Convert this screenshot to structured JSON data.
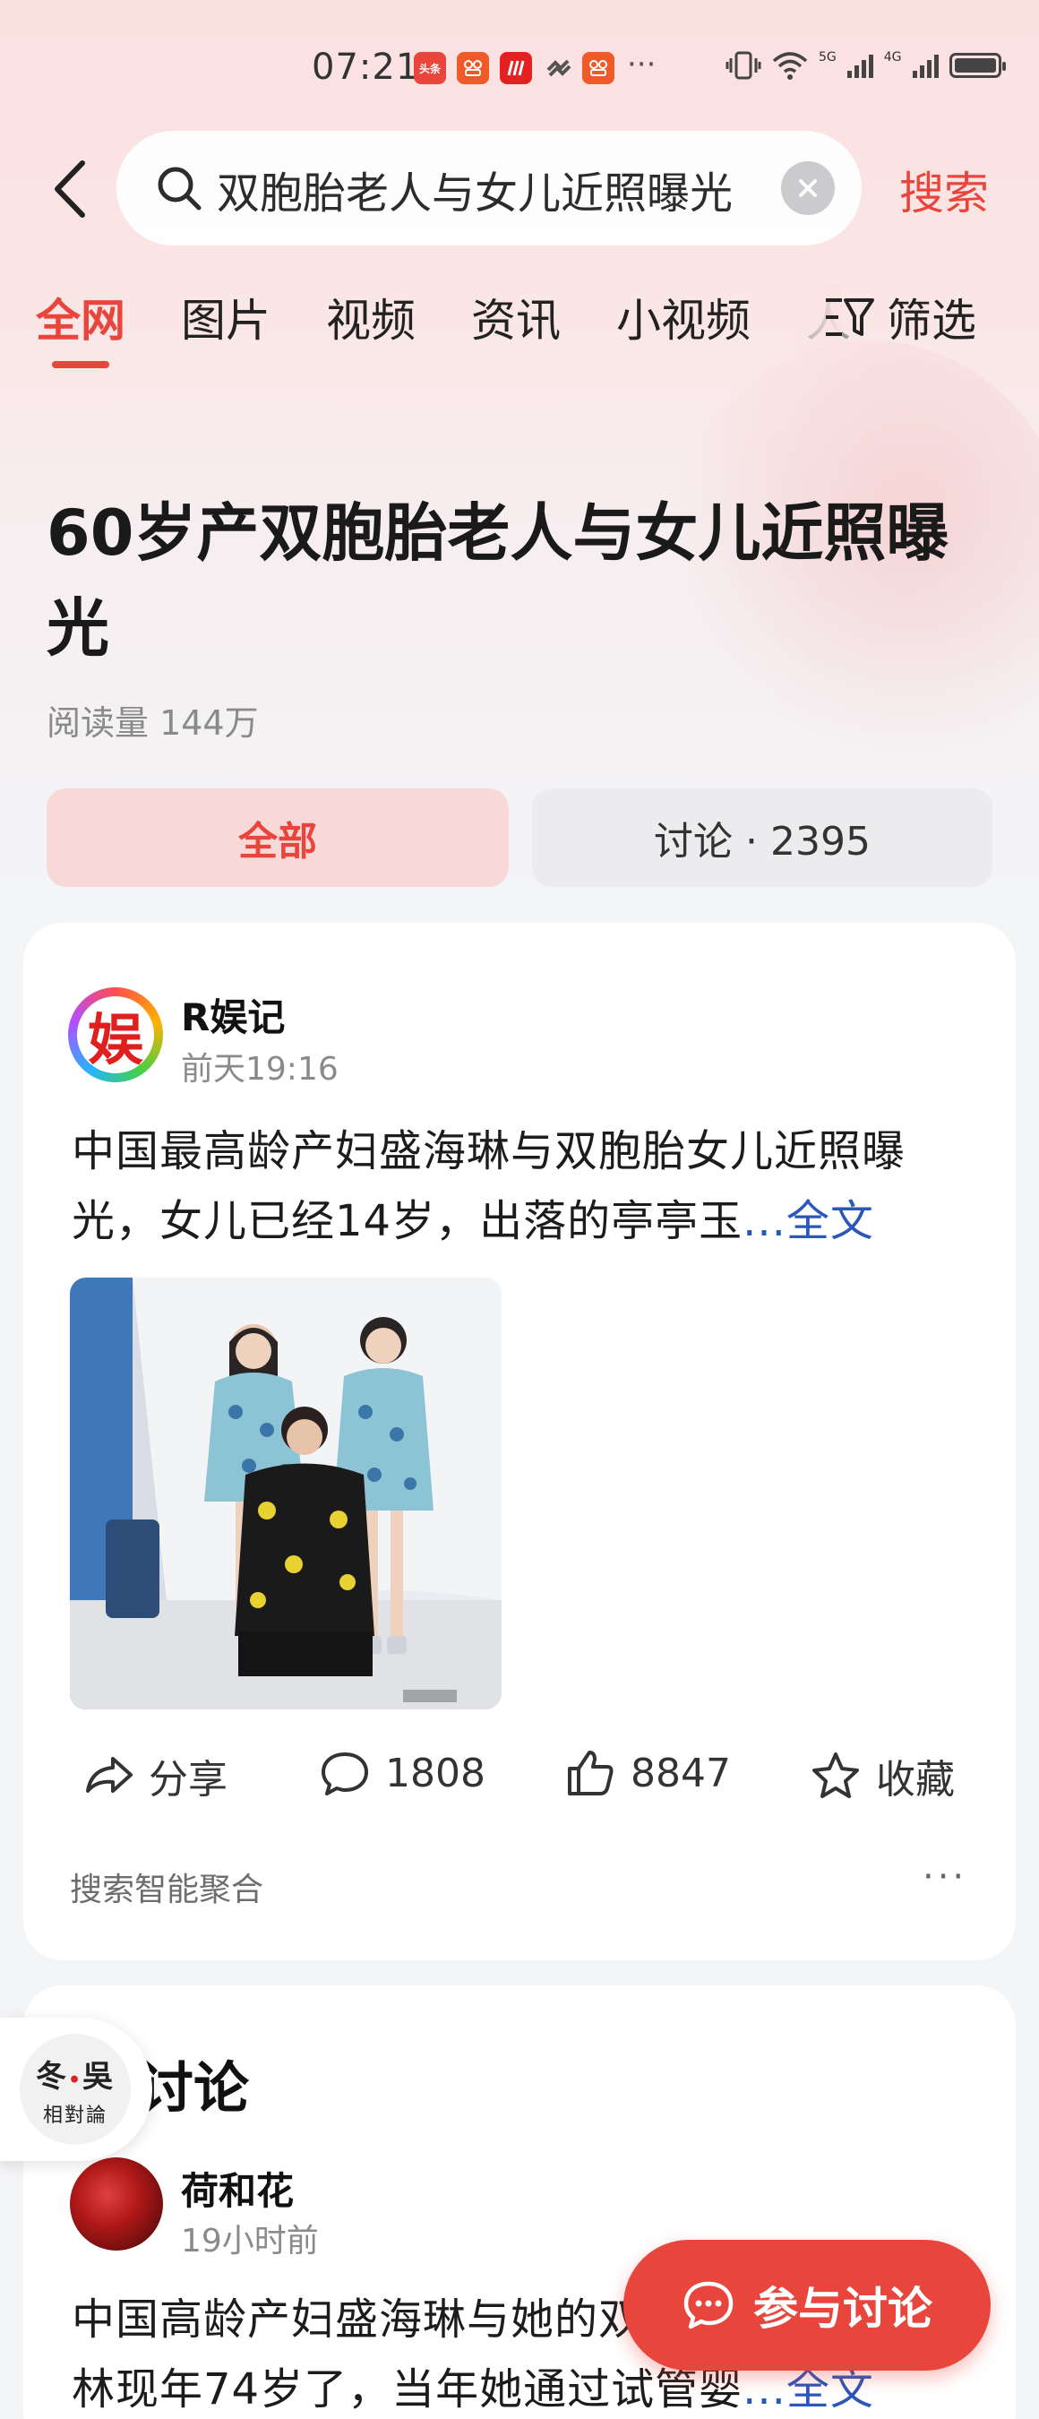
{
  "status_bar": {
    "time": "07:21",
    "more": "···",
    "network_5g": "5G",
    "network_4g": "4G",
    "notification_icons": [
      {
        "name": "toutiao-app-icon",
        "label": "头条",
        "color": "#e8453c"
      },
      {
        "name": "app-icon-2",
        "label": "",
        "color": "#f05a28"
      },
      {
        "name": "app-icon-3",
        "label": "",
        "color": "#e52020"
      },
      {
        "name": "app-icon-4",
        "label": "",
        "color": "#555555"
      },
      {
        "name": "app-icon-5",
        "label": "",
        "color": "#f05a28"
      }
    ]
  },
  "search": {
    "query": "双胞胎老人与女儿近照曝光",
    "submit_label": "搜索"
  },
  "tabs": [
    {
      "label": "全网",
      "active": true
    },
    {
      "label": "图片",
      "active": false
    },
    {
      "label": "视频",
      "active": false
    },
    {
      "label": "资讯",
      "active": false
    },
    {
      "label": "小视频",
      "active": false
    },
    {
      "label": "人",
      "active": false
    }
  ],
  "filter_label": "筛选",
  "topic": {
    "title": "60岁产双胞胎老人与女儿近照曝光",
    "read_count": "阅读量 144万",
    "segment_all": "全部",
    "segment_discussion": "讨论 · 2395"
  },
  "post": {
    "author": "R娱记",
    "avatar_char": "娱",
    "time": "前天19:16",
    "text": "中国最高龄产妇盛海琳与双胞胎女儿近照曝光，女儿已经14岁，出落的亭亭玉",
    "more": "...全文",
    "actions": {
      "share": "分享",
      "comments": "1808",
      "likes": "8847",
      "favorite": "收藏"
    },
    "aggregate_label": "搜索智能聚合",
    "more_menu": "···"
  },
  "discussion": {
    "section_title": "讨论",
    "author": "荷和花",
    "time": "19小时前",
    "text": "中国高龄产妇盛海琳与她的双胞胎女儿，盛海林现年74岁了，当年她通过试管婴",
    "more": "...全文"
  },
  "float_widget": {
    "line1_a": "冬",
    "line1_dot": "•",
    "line1_b": "吳",
    "line2": "相對論"
  },
  "join_button": "参与讨论",
  "colors": {
    "accent": "#e8453c",
    "link": "#2a57b8"
  }
}
